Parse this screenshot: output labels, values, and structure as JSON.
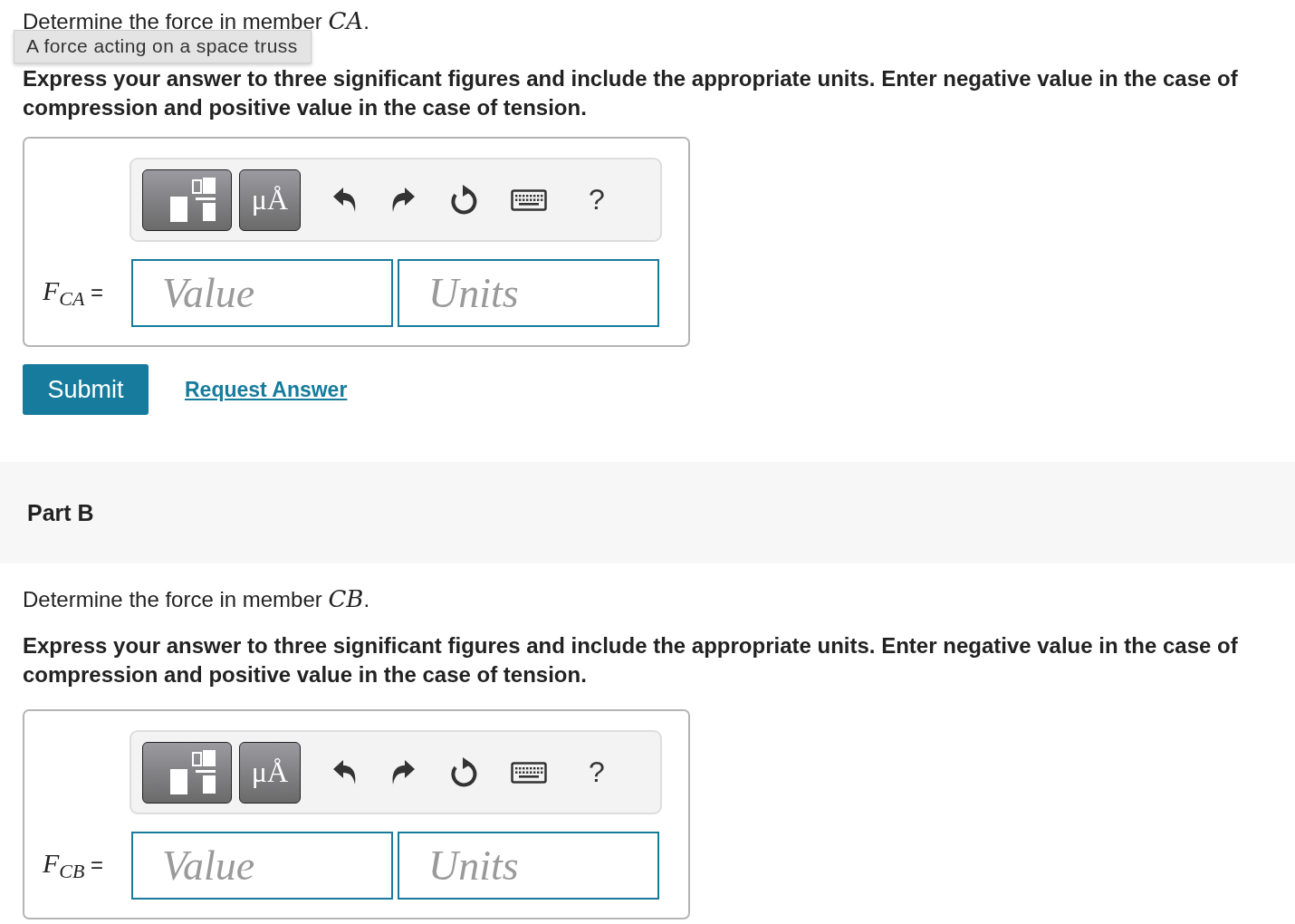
{
  "tooltip": "A force acting on a space truss",
  "parts": [
    {
      "prompt": "Determine the force in member *CA*.",
      "instructions": "Express your answer to three significant figures and include the appropriate units. Enter negative value in the case of compression and positive value in the case of tension.",
      "toolbar": {
        "units_label": "μÅ",
        "help_label": "?"
      },
      "label": "*F*$_{CA}$ =",
      "value_placeholder": "Value",
      "units_placeholder": "Units",
      "actions": {
        "submit": "Submit",
        "request": "Request Answer"
      }
    },
    {
      "header": "Part B",
      "prompt": "Determine the force in member *CB*.",
      "instructions": "Express your answer to three significant figures and include the appropriate units. Enter negative value in the case of compression and positive value in the case of tension.",
      "toolbar": {
        "units_label": "μÅ",
        "help_label": "?"
      },
      "label": "*F*$_{CB}$ =",
      "value_placeholder": "Value",
      "units_placeholder": "Units"
    }
  ]
}
